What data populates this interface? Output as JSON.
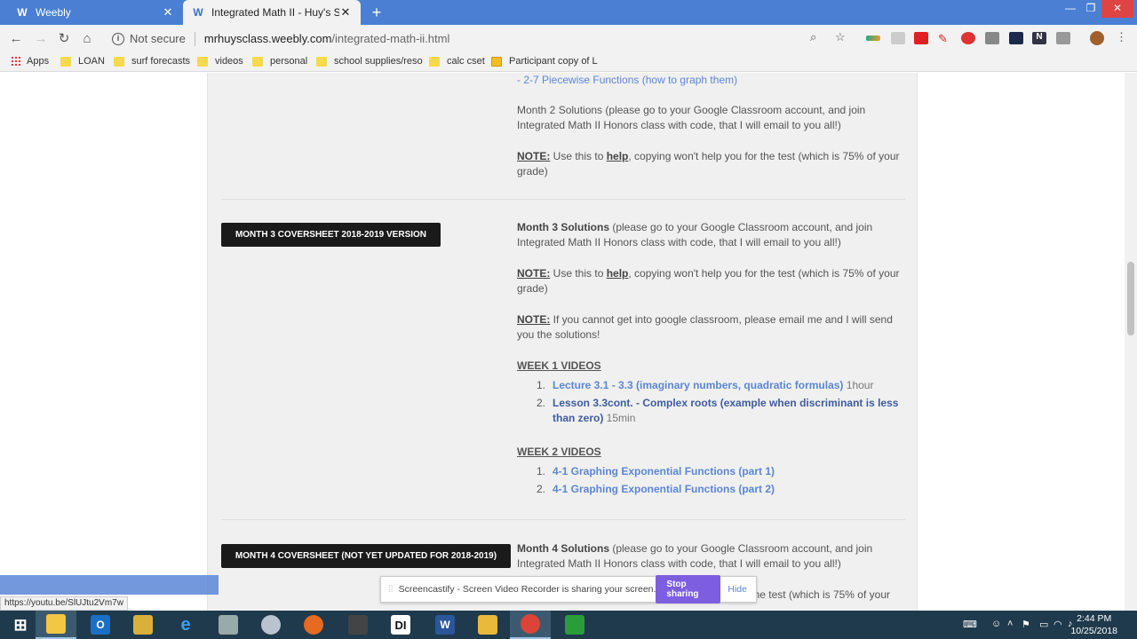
{
  "tabs": [
    {
      "title": "Weebly",
      "active": false
    },
    {
      "title": "Integrated Math II - Huy's Site",
      "active": true
    }
  ],
  "window_controls": {
    "minimize": "—",
    "maximize": "❐",
    "close": "✕"
  },
  "address": {
    "security": "Not secure",
    "host": "mrhuysclass.weebly.com",
    "path": "/integrated-math-ii.html"
  },
  "bookmarks": [
    "Apps",
    "LOAN",
    "surf forecasts",
    "videos",
    "personal",
    "school supplies/reso",
    "calc cset",
    "Participant copy of L"
  ],
  "top_link": "- 2-7 Piecewise Functions (how to graph them)",
  "month2": {
    "solutions": "Month 2 Solutions (please go to your Google Classroom account, and join Integrated Math II Honors class with code, that I will email to you all!)",
    "note_label": "NOTE:",
    "note_pre": " Use this to ",
    "note_help": "help",
    "note_post": ", copying won't help you for the test (which is 75% of your grade)"
  },
  "month3": {
    "button": "MONTH 3 COVERSHEET 2018-2019 VERSION",
    "solutions_bold": "Month 3 Solutions",
    "solutions_rest": " (please go to your Google Classroom account, and join Integrated Math II Honors class with code, that I will email to you all!)",
    "note_label": "NOTE:",
    "note_pre": " Use this to ",
    "note_help": "help",
    "note_post": ", copying won't help you for the test (which is 75% of your grade)",
    "note2_label": "NOTE:",
    "note2_text": " If you cannot get into google classroom, please email me and I will send you the solutions!",
    "week1": "WEEK 1 VIDEOS",
    "week1_items": [
      {
        "num": "1.",
        "link": "Lecture 3.1 - 3.3 (imaginary numbers, quadratic formulas)",
        "dur": " 1hour"
      },
      {
        "num": "2.",
        "link": "Lesson 3.3cont. - Complex roots (example when discriminant is less than zero)",
        "dur": " 15min"
      }
    ],
    "week2": "WEEK 2 VIDEOS",
    "week2_items": [
      {
        "num": "1.",
        "link": "4-1 Graphing Exponential Functions (part 1)"
      },
      {
        "num": "2.",
        "link": "4-1 Graphing Exponential Functions (part 2)"
      }
    ]
  },
  "month4": {
    "button": "MONTH 4 COVERSHEET (NOT YET UPDATED FOR 2018-2019)",
    "solutions_bold": "Month 4 Solutions",
    "solutions_rest": " (please go to your Google Classroom account, and join Integrated Math II Honors class with code, that I will email to you all!)",
    "note_tail": "the test (which is 75% of your"
  },
  "status_url": "https://youtu.be/SlUJtu2Vm7w",
  "share": {
    "message": "Screencastify - Screen Video Recorder is sharing your screen.",
    "stop": "Stop sharing",
    "hide": "Hide"
  },
  "clock": {
    "time": "2:44 PM",
    "date": "10/25/2018"
  },
  "colors": {
    "tabbar": "#4a7fd4",
    "link": "#5b86d6",
    "button": "#1a1a1a",
    "stop": "#7d5ee0",
    "taskbar": "#1f3a4d"
  }
}
